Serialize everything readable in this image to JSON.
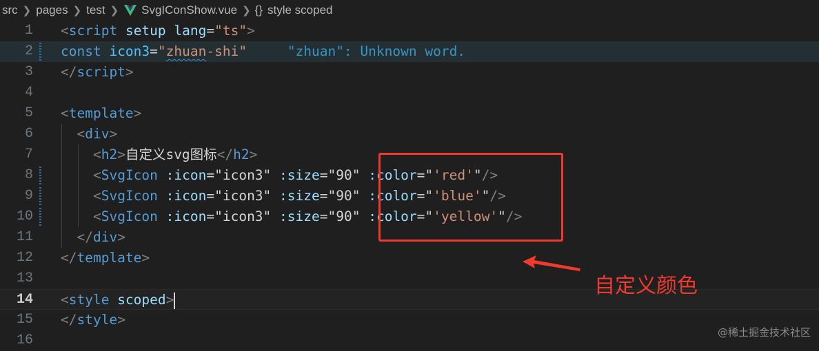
{
  "breadcrumb": {
    "segments": [
      "src",
      "pages",
      "test"
    ],
    "file": "SvgIConShow.vue",
    "braces": "{}",
    "symbol": "style scoped"
  },
  "lines": [
    {
      "no": "1",
      "tokens": [
        {
          "t": "<",
          "c": "tg"
        },
        {
          "t": "script",
          "c": "tn"
        },
        {
          "t": " "
        },
        {
          "t": "setup",
          "c": "at"
        },
        {
          "t": " "
        },
        {
          "t": "lang",
          "c": "at"
        },
        {
          "t": "="
        },
        {
          "t": "\"ts\"",
          "c": "st"
        },
        {
          "t": ">",
          "c": "tg"
        }
      ]
    },
    {
      "no": "2",
      "tokens": [
        {
          "t": "const",
          "c": "kw"
        },
        {
          "t": " "
        },
        {
          "t": "icon3",
          "c": "vr"
        },
        {
          "t": "="
        },
        {
          "t": "\"",
          "c": "st"
        },
        {
          "t": "zhuan",
          "c": "st squiggle"
        },
        {
          "t": "-shi\"",
          "c": "st"
        },
        {
          "t": "     "
        },
        {
          "t": "\"zhuan\": Unknown word.",
          "c": "diag"
        }
      ]
    },
    {
      "no": "3",
      "tokens": [
        {
          "t": "</",
          "c": "tg"
        },
        {
          "t": "script",
          "c": "tn"
        },
        {
          "t": ">",
          "c": "tg"
        }
      ]
    },
    {
      "no": "4",
      "tokens": []
    },
    {
      "no": "5",
      "tokens": [
        {
          "t": "<",
          "c": "tg"
        },
        {
          "t": "template",
          "c": "tn"
        },
        {
          "t": ">",
          "c": "tg"
        }
      ]
    },
    {
      "no": "6",
      "tokens": [
        {
          "t": "  "
        },
        {
          "t": "<",
          "c": "tg"
        },
        {
          "t": "div",
          "c": "tn"
        },
        {
          "t": ">",
          "c": "tg"
        }
      ]
    },
    {
      "no": "7",
      "tokens": [
        {
          "t": "    "
        },
        {
          "t": "<",
          "c": "tg"
        },
        {
          "t": "h2",
          "c": "tn"
        },
        {
          "t": ">",
          "c": "tg"
        },
        {
          "t": "自定义svg图标",
          "c": "tx"
        },
        {
          "t": "</",
          "c": "tg"
        },
        {
          "t": "h2",
          "c": "tn"
        },
        {
          "t": ">",
          "c": "tg"
        }
      ]
    },
    {
      "no": "8",
      "tokens": [
        {
          "t": "    "
        },
        {
          "t": "<",
          "c": "tg"
        },
        {
          "t": "SvgIcon",
          "c": "tn"
        },
        {
          "t": " "
        },
        {
          "t": ":icon",
          "c": "at"
        },
        {
          "t": "="
        },
        {
          "t": "\"icon3\"",
          "c": "tx"
        },
        {
          "t": " "
        },
        {
          "t": ":size",
          "c": "at"
        },
        {
          "t": "="
        },
        {
          "t": "\"90\"",
          "c": "tx"
        },
        {
          "t": " "
        },
        {
          "t": ":color",
          "c": "at"
        },
        {
          "t": "="
        },
        {
          "t": "\"",
          "c": "tx"
        },
        {
          "t": "'red'",
          "c": "st"
        },
        {
          "t": "\"",
          "c": "tx"
        },
        {
          "t": "/>",
          "c": "tg"
        }
      ]
    },
    {
      "no": "9",
      "tokens": [
        {
          "t": "    "
        },
        {
          "t": "<",
          "c": "tg"
        },
        {
          "t": "SvgIcon",
          "c": "tn"
        },
        {
          "t": " "
        },
        {
          "t": ":icon",
          "c": "at"
        },
        {
          "t": "="
        },
        {
          "t": "\"icon3\"",
          "c": "tx"
        },
        {
          "t": " "
        },
        {
          "t": ":size",
          "c": "at"
        },
        {
          "t": "="
        },
        {
          "t": "\"90\"",
          "c": "tx"
        },
        {
          "t": " "
        },
        {
          "t": ":color",
          "c": "at"
        },
        {
          "t": "="
        },
        {
          "t": "\"",
          "c": "tx"
        },
        {
          "t": "'blue'",
          "c": "st"
        },
        {
          "t": "\"",
          "c": "tx"
        },
        {
          "t": "/>",
          "c": "tg"
        }
      ]
    },
    {
      "no": "10",
      "tokens": [
        {
          "t": "    "
        },
        {
          "t": "<",
          "c": "tg"
        },
        {
          "t": "SvgIcon",
          "c": "tn"
        },
        {
          "t": " "
        },
        {
          "t": ":icon",
          "c": "at"
        },
        {
          "t": "="
        },
        {
          "t": "\"icon3\"",
          "c": "tx"
        },
        {
          "t": " "
        },
        {
          "t": ":size",
          "c": "at"
        },
        {
          "t": "="
        },
        {
          "t": "\"90\"",
          "c": "tx"
        },
        {
          "t": " "
        },
        {
          "t": ":color",
          "c": "at"
        },
        {
          "t": "="
        },
        {
          "t": "\"",
          "c": "tx"
        },
        {
          "t": "'yellow'",
          "c": "st"
        },
        {
          "t": "\"",
          "c": "tx"
        },
        {
          "t": "/>",
          "c": "tg"
        }
      ]
    },
    {
      "no": "11",
      "tokens": [
        {
          "t": "  "
        },
        {
          "t": "</",
          "c": "tg"
        },
        {
          "t": "div",
          "c": "tn"
        },
        {
          "t": ">",
          "c": "tg"
        }
      ]
    },
    {
      "no": "12",
      "tokens": [
        {
          "t": "</",
          "c": "tg"
        },
        {
          "t": "template",
          "c": "tn"
        },
        {
          "t": ">",
          "c": "tg"
        }
      ]
    },
    {
      "no": "13",
      "tokens": []
    },
    {
      "no": "14",
      "tokens": [
        {
          "t": "<",
          "c": "tg"
        },
        {
          "t": "style",
          "c": "tn"
        },
        {
          "t": " "
        },
        {
          "t": "scoped",
          "c": "at"
        },
        {
          "t": ">",
          "c": "tg"
        }
      ]
    },
    {
      "no": "15",
      "tokens": [
        {
          "t": "</",
          "c": "tg"
        },
        {
          "t": "style",
          "c": "tn"
        },
        {
          "t": ">",
          "c": "tg"
        }
      ]
    },
    {
      "no": "16",
      "tokens": []
    }
  ],
  "annotation": {
    "label": "自定义颜色",
    "color": "#f03a2e"
  },
  "watermark": "@稀土掘金技术社区",
  "colors": {
    "background": "#1f1f1f",
    "tag": "#569cd6",
    "attribute": "#9cdcfe",
    "string": "#ce9178",
    "diagnostic": "#3794c6"
  }
}
